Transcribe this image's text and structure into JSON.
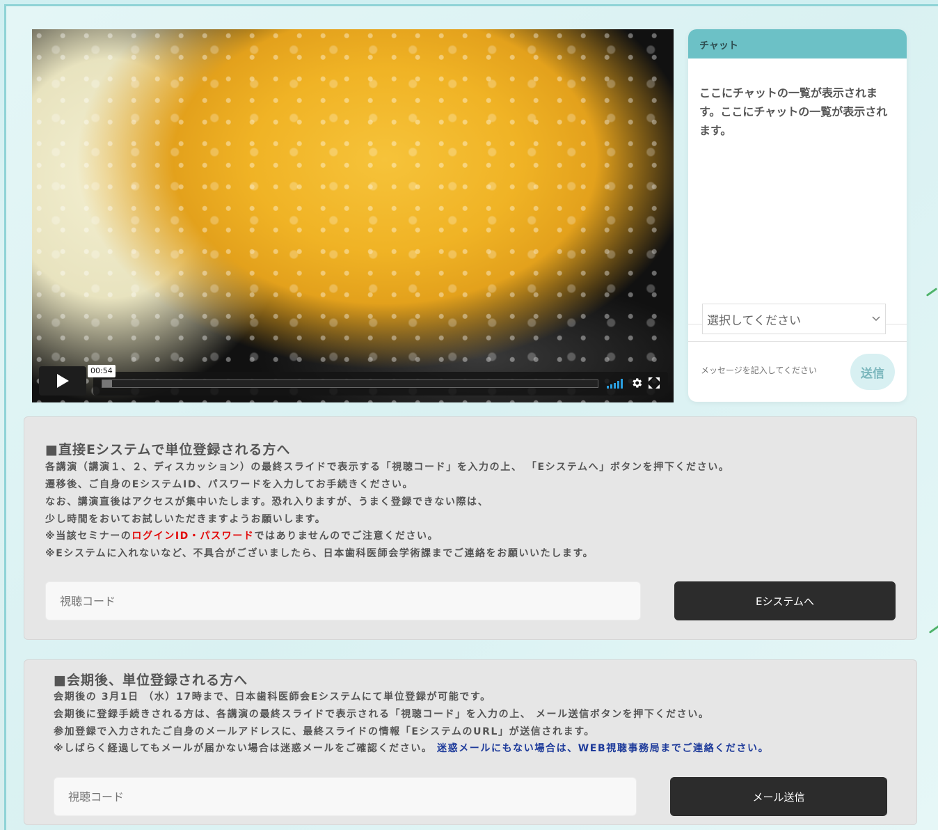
{
  "video": {
    "timecode": "00:54",
    "progress": 0.02,
    "icons": [
      "play-icon",
      "volume-icon",
      "gear-icon",
      "fullscreen-icon"
    ]
  },
  "chat": {
    "header": "チャット",
    "list_text": "ここにチャットの一覧が表示されます。ここにチャットの一覧が表示されます。",
    "select_value": "選択してください",
    "message_placeholder": "メッセージを記入してください",
    "send_label": "送信"
  },
  "section1": {
    "title": "■直接Eシステムで単位登録される方へ",
    "line1": "各講演（講演１、２、ディスカッション）の最終スライドで表示する「視聴コード」を入力の上、 「Eシステムへ」ボタンを押下ください。",
    "line2": "遷移後、ご自身のEシステムID、パスワードを入力してお手続きください。",
    "line3": "なお、講演直後はアクセスが集中いたします。恐れ入りますが、うまく登録できない際は、",
    "line4": "少し時間をおいてお試しいただきますようお願いします。",
    "line5_pre": "※当該セミナーの",
    "line5_red": "ログインID・パスワード",
    "line5_post": "ではありませんのでご注意ください。",
    "line6": "※Eシステムに入れないなど、不具合がございましたら、日本歯科医師会学術課までご連絡をお願いいたします。",
    "code_placeholder": "視聴コード",
    "button_label": "Eシステムへ"
  },
  "section2": {
    "title": "■会期後、単位登録される方へ",
    "line1": "会期後の 3月1日 （水）17時まで、日本歯科医師会Eシステムにて単位登録が可能です。",
    "line2": "会期後に登録手続きされる方は、各講演の最終スライドで表示される「視聴コード」を入力の上、 メール送信ボタンを押下ください。",
    "line3": "参加登録で入力されたご自身のメールアドレスに、最終スライドの情報「EシステムのURL」が送信されます。",
    "line4_pre": "※しばらく経過してもメールが届かない場合は迷惑メールをご確認ください。 ",
    "line4_blue": "迷惑メールにもない場合は、WEB視聴事務局までご連絡ください。",
    "code_placeholder": "視聴コード",
    "button_label": "メール送信"
  },
  "colors": {
    "accent": "#6cc1c6",
    "dark_button": "#2c2c2c",
    "warning_red": "#e20a0a",
    "link_blue": "#1d3a9a"
  }
}
